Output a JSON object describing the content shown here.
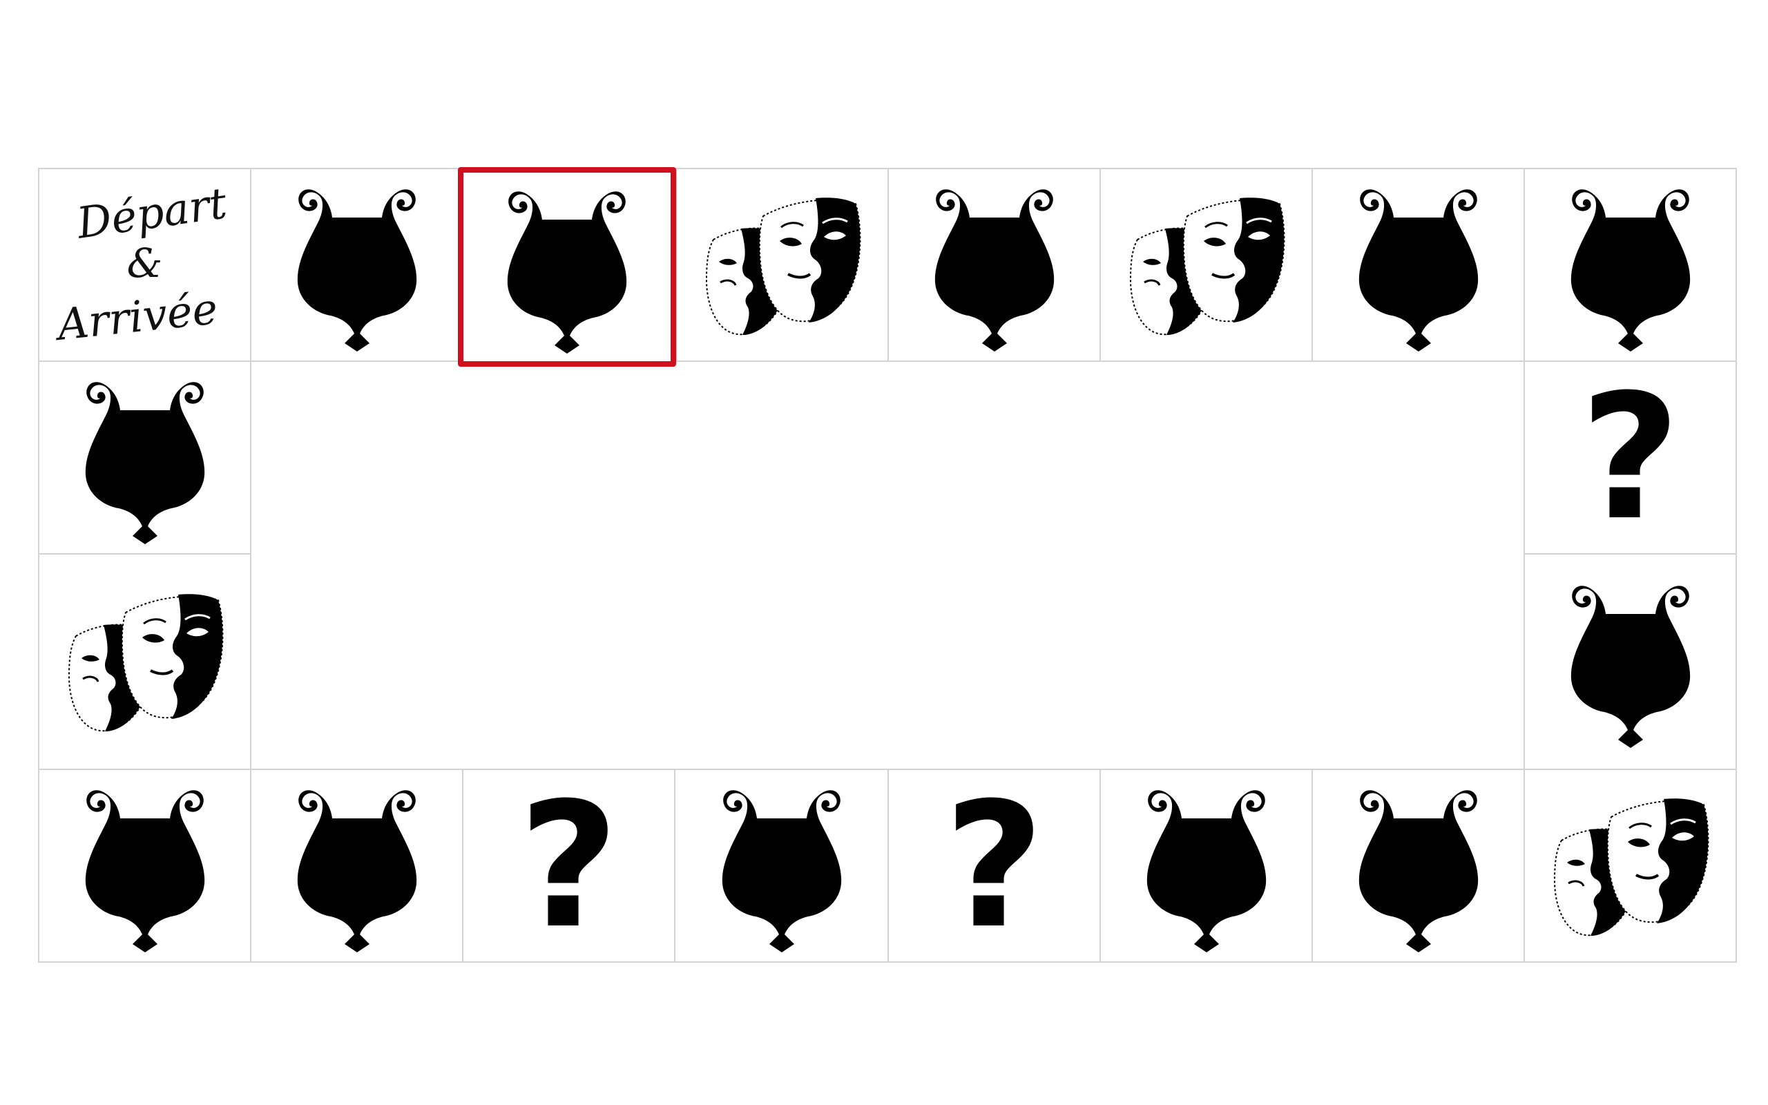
{
  "board": {
    "start_cell": {
      "label_top": "Départ",
      "label_mid": "&",
      "label_bottom": "Arrivée"
    },
    "question_mark": "?",
    "selected_cell": "top-3",
    "colors": {
      "selection": "#d0101e",
      "grid_line": "#d3d3d3",
      "icon": "#000000"
    },
    "cells": [
      {
        "id": "top-1",
        "type": "start"
      },
      {
        "id": "top-2",
        "type": "lyre"
      },
      {
        "id": "top-3",
        "type": "lyre"
      },
      {
        "id": "top-4",
        "type": "masks"
      },
      {
        "id": "top-5",
        "type": "lyre"
      },
      {
        "id": "top-6",
        "type": "masks"
      },
      {
        "id": "top-7",
        "type": "lyre"
      },
      {
        "id": "top-8",
        "type": "lyre"
      },
      {
        "id": "left-1",
        "type": "lyre"
      },
      {
        "id": "left-2",
        "type": "masks"
      },
      {
        "id": "right-1",
        "type": "question"
      },
      {
        "id": "right-2",
        "type": "lyre"
      },
      {
        "id": "bottom-1",
        "type": "lyre"
      },
      {
        "id": "bottom-2",
        "type": "lyre"
      },
      {
        "id": "bottom-3",
        "type": "question"
      },
      {
        "id": "bottom-4",
        "type": "lyre"
      },
      {
        "id": "bottom-5",
        "type": "question"
      },
      {
        "id": "bottom-6",
        "type": "lyre"
      },
      {
        "id": "bottom-7",
        "type": "lyre"
      },
      {
        "id": "bottom-8",
        "type": "masks"
      }
    ]
  }
}
